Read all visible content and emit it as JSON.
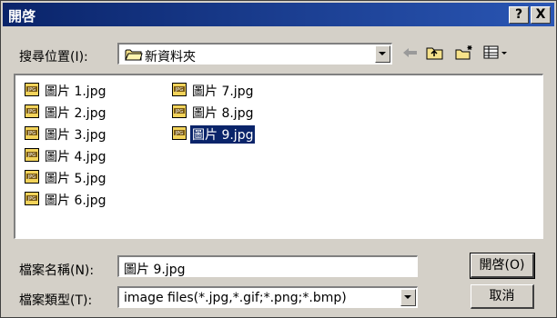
{
  "window": {
    "title": "開啓",
    "help_btn": "?",
    "close_btn": "X"
  },
  "look_in": {
    "label": "搜尋位置(I):",
    "value": "新資料夾"
  },
  "files": [
    "圖片 1.jpg",
    "圖片 2.jpg",
    "圖片 3.jpg",
    "圖片 4.jpg",
    "圖片 5.jpg",
    "圖片 6.jpg",
    "圖片 7.jpg",
    "圖片 8.jpg",
    "圖片 9.jpg"
  ],
  "selected_file": "圖片 9.jpg",
  "filename": {
    "label": "檔案名稱(N):",
    "value": "圖片 9.jpg"
  },
  "filetype": {
    "label": "檔案類型(T):",
    "value": "image files(*.jpg,*.gif;*.png;*.bmp)"
  },
  "buttons": {
    "open": "開啓(O)",
    "cancel": "取消"
  },
  "icons": {
    "back": "back-arrow-icon",
    "up": "up-folder-icon",
    "new_folder": "new-folder-icon",
    "view": "view-menu-icon"
  },
  "colors": {
    "title_bar": "#0a246a",
    "selection": "#0a246a",
    "face": "#d4d0c8"
  }
}
